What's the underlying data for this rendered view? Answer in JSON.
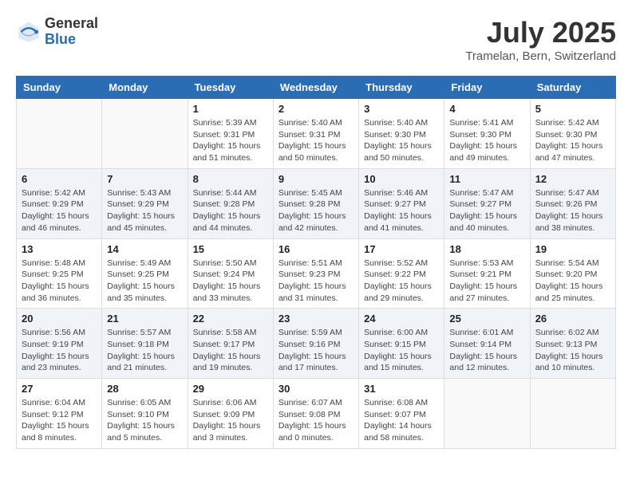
{
  "logo": {
    "general": "General",
    "blue": "Blue"
  },
  "header": {
    "month": "July 2025",
    "location": "Tramelan, Bern, Switzerland"
  },
  "weekdays": [
    "Sunday",
    "Monday",
    "Tuesday",
    "Wednesday",
    "Thursday",
    "Friday",
    "Saturday"
  ],
  "weeks": [
    [
      {
        "day": "",
        "info": ""
      },
      {
        "day": "",
        "info": ""
      },
      {
        "day": "1",
        "info": "Sunrise: 5:39 AM\nSunset: 9:31 PM\nDaylight: 15 hours and 51 minutes."
      },
      {
        "day": "2",
        "info": "Sunrise: 5:40 AM\nSunset: 9:31 PM\nDaylight: 15 hours and 50 minutes."
      },
      {
        "day": "3",
        "info": "Sunrise: 5:40 AM\nSunset: 9:30 PM\nDaylight: 15 hours and 50 minutes."
      },
      {
        "day": "4",
        "info": "Sunrise: 5:41 AM\nSunset: 9:30 PM\nDaylight: 15 hours and 49 minutes."
      },
      {
        "day": "5",
        "info": "Sunrise: 5:42 AM\nSunset: 9:30 PM\nDaylight: 15 hours and 47 minutes."
      }
    ],
    [
      {
        "day": "6",
        "info": "Sunrise: 5:42 AM\nSunset: 9:29 PM\nDaylight: 15 hours and 46 minutes."
      },
      {
        "day": "7",
        "info": "Sunrise: 5:43 AM\nSunset: 9:29 PM\nDaylight: 15 hours and 45 minutes."
      },
      {
        "day": "8",
        "info": "Sunrise: 5:44 AM\nSunset: 9:28 PM\nDaylight: 15 hours and 44 minutes."
      },
      {
        "day": "9",
        "info": "Sunrise: 5:45 AM\nSunset: 9:28 PM\nDaylight: 15 hours and 42 minutes."
      },
      {
        "day": "10",
        "info": "Sunrise: 5:46 AM\nSunset: 9:27 PM\nDaylight: 15 hours and 41 minutes."
      },
      {
        "day": "11",
        "info": "Sunrise: 5:47 AM\nSunset: 9:27 PM\nDaylight: 15 hours and 40 minutes."
      },
      {
        "day": "12",
        "info": "Sunrise: 5:47 AM\nSunset: 9:26 PM\nDaylight: 15 hours and 38 minutes."
      }
    ],
    [
      {
        "day": "13",
        "info": "Sunrise: 5:48 AM\nSunset: 9:25 PM\nDaylight: 15 hours and 36 minutes."
      },
      {
        "day": "14",
        "info": "Sunrise: 5:49 AM\nSunset: 9:25 PM\nDaylight: 15 hours and 35 minutes."
      },
      {
        "day": "15",
        "info": "Sunrise: 5:50 AM\nSunset: 9:24 PM\nDaylight: 15 hours and 33 minutes."
      },
      {
        "day": "16",
        "info": "Sunrise: 5:51 AM\nSunset: 9:23 PM\nDaylight: 15 hours and 31 minutes."
      },
      {
        "day": "17",
        "info": "Sunrise: 5:52 AM\nSunset: 9:22 PM\nDaylight: 15 hours and 29 minutes."
      },
      {
        "day": "18",
        "info": "Sunrise: 5:53 AM\nSunset: 9:21 PM\nDaylight: 15 hours and 27 minutes."
      },
      {
        "day": "19",
        "info": "Sunrise: 5:54 AM\nSunset: 9:20 PM\nDaylight: 15 hours and 25 minutes."
      }
    ],
    [
      {
        "day": "20",
        "info": "Sunrise: 5:56 AM\nSunset: 9:19 PM\nDaylight: 15 hours and 23 minutes."
      },
      {
        "day": "21",
        "info": "Sunrise: 5:57 AM\nSunset: 9:18 PM\nDaylight: 15 hours and 21 minutes."
      },
      {
        "day": "22",
        "info": "Sunrise: 5:58 AM\nSunset: 9:17 PM\nDaylight: 15 hours and 19 minutes."
      },
      {
        "day": "23",
        "info": "Sunrise: 5:59 AM\nSunset: 9:16 PM\nDaylight: 15 hours and 17 minutes."
      },
      {
        "day": "24",
        "info": "Sunrise: 6:00 AM\nSunset: 9:15 PM\nDaylight: 15 hours and 15 minutes."
      },
      {
        "day": "25",
        "info": "Sunrise: 6:01 AM\nSunset: 9:14 PM\nDaylight: 15 hours and 12 minutes."
      },
      {
        "day": "26",
        "info": "Sunrise: 6:02 AM\nSunset: 9:13 PM\nDaylight: 15 hours and 10 minutes."
      }
    ],
    [
      {
        "day": "27",
        "info": "Sunrise: 6:04 AM\nSunset: 9:12 PM\nDaylight: 15 hours and 8 minutes."
      },
      {
        "day": "28",
        "info": "Sunrise: 6:05 AM\nSunset: 9:10 PM\nDaylight: 15 hours and 5 minutes."
      },
      {
        "day": "29",
        "info": "Sunrise: 6:06 AM\nSunset: 9:09 PM\nDaylight: 15 hours and 3 minutes."
      },
      {
        "day": "30",
        "info": "Sunrise: 6:07 AM\nSunset: 9:08 PM\nDaylight: 15 hours and 0 minutes."
      },
      {
        "day": "31",
        "info": "Sunrise: 6:08 AM\nSunset: 9:07 PM\nDaylight: 14 hours and 58 minutes."
      },
      {
        "day": "",
        "info": ""
      },
      {
        "day": "",
        "info": ""
      }
    ]
  ]
}
